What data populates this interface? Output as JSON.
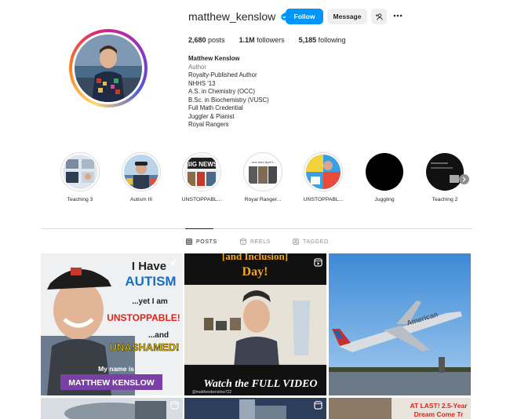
{
  "profile": {
    "username": "matthew_kenslow",
    "follow_label": "Follow",
    "message_label": "Message",
    "stats": {
      "posts": "2,680",
      "posts_label": "posts",
      "followers": "1.1M",
      "followers_label": "followers",
      "following": "5,185",
      "following_label": "following"
    },
    "bio": {
      "name": "Matthew Kenslow",
      "category": "Author",
      "lines": [
        "Royalty-Published Author",
        "NHHS '13",
        "A.S. in Chemistry (OCC)",
        "B.Sc. in Biochemistry (VUSC)",
        "Full Math Credential",
        "Juggler & Pianist",
        "Royal Rangers"
      ]
    }
  },
  "highlights": [
    {
      "label": "Teaching 3"
    },
    {
      "label": "Autism III"
    },
    {
      "label": "UNSTOPPABL..."
    },
    {
      "label": "Royal Ranger..."
    },
    {
      "label": "UNSTOPPABL..."
    },
    {
      "label": "Juggling"
    },
    {
      "label": "Teaching 2"
    }
  ],
  "highlight_thumb_texts": {
    "news": "BIG NEWS",
    "ranger_banner": "...one hour April 1..."
  },
  "tabs": [
    {
      "label": "POSTS"
    },
    {
      "label": "REELS"
    },
    {
      "label": "TAGGED"
    }
  ],
  "posts": {
    "autism": {
      "line1": "I Have",
      "line2": "AUTISM",
      "line3": "...yet I am",
      "line4": "UNSTOPPABLE!",
      "line5": "...and",
      "line6": "UNASHAMED!",
      "name_intro": "My name is",
      "name": "MATTHEW KENSLOW"
    },
    "video": {
      "top_text": "[and Inclusion]",
      "top_text2": "Day!",
      "watch": "Watch the FULL VIDEO",
      "handle": "@matthewkenslow722"
    },
    "airplane": {
      "brand": "American"
    },
    "row2_right": {
      "text1": "AT LAST! 2.5-Year",
      "text2": "Dream Come Tr"
    }
  },
  "colors": {
    "follow_blue": "#0095f6",
    "autism_blue": "#1b6ec2",
    "unstoppable_red": "#e0241b",
    "name_banner_purple": "#7b3fa8",
    "yellow_text": "#ffd400"
  }
}
